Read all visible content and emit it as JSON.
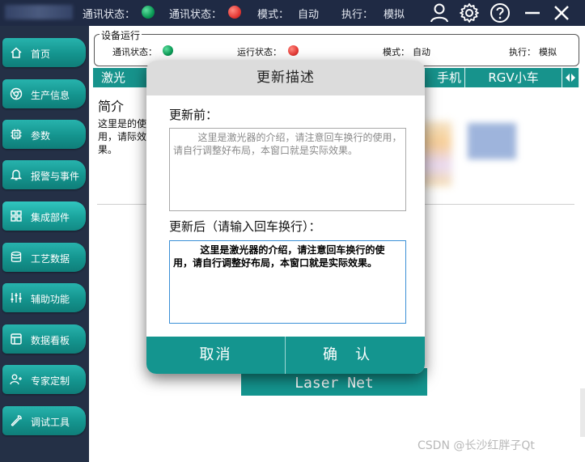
{
  "topbar": {
    "comm_label_1": "通讯状态：",
    "comm_label_2": "通讯状态：",
    "mode_label": "模式：",
    "mode_value": "自动",
    "exec_label": "执行：",
    "exec_value": "模拟",
    "status_colors": {
      "ok": "#0a9a55",
      "error": "#e53935"
    },
    "icons": [
      "user-icon",
      "gear-icon",
      "help-icon",
      "minimize-icon",
      "close-icon"
    ]
  },
  "sidebar": {
    "items": [
      {
        "label": "首页",
        "icon": "home-icon"
      },
      {
        "label": "生产信息",
        "icon": "chrome-icon"
      },
      {
        "label": "参数",
        "icon": "chip-icon"
      },
      {
        "label": "报警与事件",
        "icon": "bell-icon"
      },
      {
        "label": "集成部件",
        "icon": "grid-icon",
        "active": true
      },
      {
        "label": "工艺数据",
        "icon": "database-icon"
      },
      {
        "label": "辅助功能",
        "icon": "sliders-icon"
      },
      {
        "label": "数据看板",
        "icon": "layout-icon"
      },
      {
        "label": "专家定制",
        "icon": "user-plus-icon"
      },
      {
        "label": "调试工具",
        "icon": "wrench-icon"
      }
    ]
  },
  "device_panel": {
    "title": "设备运行",
    "comm_label": "通讯状态：",
    "run_label": "运行状态：",
    "mode_label": "模式：",
    "mode_value": "自动",
    "exec_label": "执行：",
    "exec_value": "模拟"
  },
  "tabs": {
    "items": [
      "激光",
      "手机",
      "RGV小车"
    ]
  },
  "main": {
    "intro_title": "简介",
    "intro_text": "这里是的使用，请际效果。",
    "lasernet_label": "Laser Net"
  },
  "modal": {
    "title": "更新描述",
    "before_label": "更新前：",
    "before_text": "        这里是激光器的介绍，请注意回车换行的使用，请自行调整好布局，本窗口就是实际效果。",
    "after_label": "更新后（请输入回车换行）：",
    "after_text": "        这里是激光器的介绍，请注意回车换行的使用，请自行调整好布局，本窗口就是实际效果。",
    "cancel_label": "取消",
    "confirm_label": "确认",
    "accent_color": "#14958f"
  },
  "watermark": "CSDN @长沙红胖子Qt"
}
